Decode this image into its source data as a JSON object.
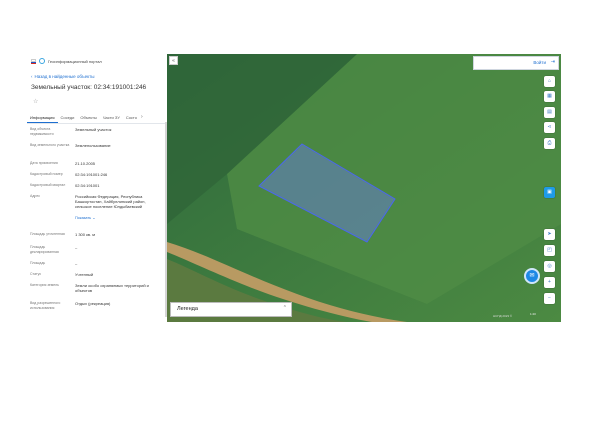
{
  "header": {
    "portal_title": "Геоинформационный портал"
  },
  "nav": {
    "back_label": "Назад в найденные объекты"
  },
  "page": {
    "title": "Земельный участок: 02:34:191001:246"
  },
  "tabs": [
    {
      "label": "Информация"
    },
    {
      "label": "Соседи"
    },
    {
      "label": "Объекты"
    },
    {
      "label": "Части ЗУ"
    },
    {
      "label": "Состо"
    }
  ],
  "info": {
    "rows": [
      {
        "label": "Вид объекта недвижимости",
        "value": "Земельный участок"
      },
      {
        "label": "Вид земельного участка",
        "value": "Землепользование"
      },
      {
        "label": "Дата присвоения",
        "value": "21.10.2005"
      },
      {
        "label": "Кадастровый номер",
        "value": "02:34:191001:246"
      },
      {
        "label": "Кадастровый квартал",
        "value": "02:34:191001"
      },
      {
        "label": "Адрес",
        "value": "Российская Федерация, Республика Башкортостан, Хайбуллинский район, сельское поселение Юлдыбаевский"
      },
      {
        "label": "Площадь уточненная",
        "value": "1 300 кв. м"
      },
      {
        "label": "Площадь декларированная",
        "value": "–"
      },
      {
        "label": "Площадь",
        "value": "–"
      },
      {
        "label": "Статус",
        "value": "Учтенный"
      },
      {
        "label": "Категория земель",
        "value": "Земли особо охраняемых территорий и объектов"
      },
      {
        "label": "Вид разрешенного использования",
        "value": "Отдых (рекреация)"
      }
    ],
    "expand_label": "Показать"
  },
  "map": {
    "login_label": "Войти",
    "legend_label": "Легенда",
    "copyright": "НСПД 2023 ©",
    "scale": "1:20"
  },
  "colors": {
    "accent": "#1e6fd0",
    "parcel": "#5a6fe0"
  }
}
